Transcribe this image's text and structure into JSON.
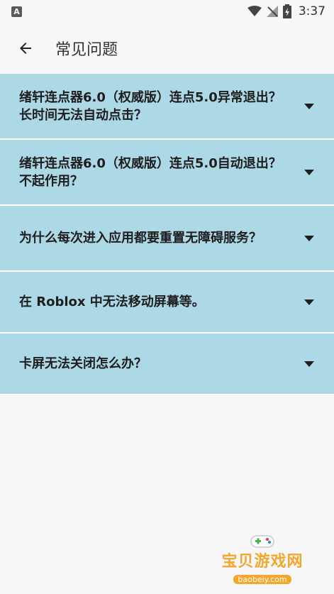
{
  "status_bar": {
    "notification_icon_label": "A",
    "time": "3:37",
    "icons": [
      "wifi-icon",
      "no-signal-icon",
      "battery-charging-icon"
    ]
  },
  "header": {
    "title": "常见问题",
    "back_icon": "arrow-left-icon"
  },
  "faq": [
    {
      "question": "绪轩连点器6.0（权威版）连点5.0异常退出？长时间无法自动点击？"
    },
    {
      "question": "绪轩连点器6.0（权威版）连点5.0自动退出？不起作用？"
    },
    {
      "question": "为什么每次进入应用都要重置无障碍服务？"
    },
    {
      "question": "在 Roblox 中无法移动屏幕等。"
    },
    {
      "question": "卡屏无法关闭怎么办？"
    }
  ],
  "watermark": {
    "text": "宝贝游戏网",
    "url": "baobeiy.com"
  },
  "colors": {
    "item_bg": "#add8e6",
    "page_bg": "#f7f7fa",
    "watermark": "#f4a72a"
  }
}
